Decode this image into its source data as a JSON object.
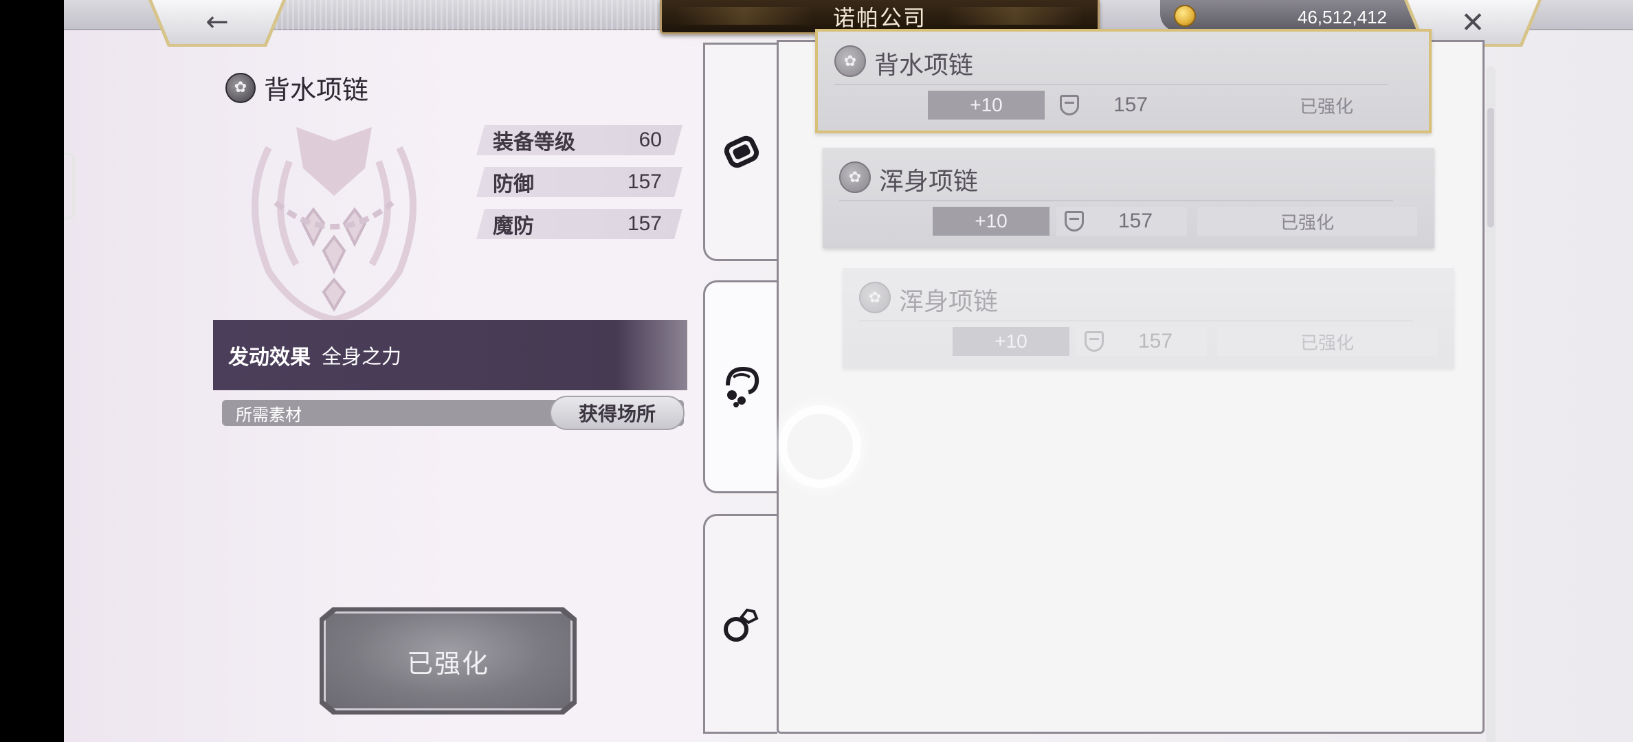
{
  "header": {
    "title": "诺帕公司",
    "back_icon": "←",
    "close_icon": "✕",
    "currency_value": "46,512,412"
  },
  "detail": {
    "item_name": "背水项链",
    "stats": [
      {
        "label": "装备等级",
        "value": "60"
      },
      {
        "label": "防御",
        "value": "157"
      },
      {
        "label": "魔防",
        "value": "157"
      }
    ],
    "effect_label": "发动效果",
    "effect_value": "全身之力",
    "materials_label": "所需素材",
    "source_button": "获得场所",
    "enhance_button": "已强化"
  },
  "tabs": [
    {
      "icon": "bracelet-icon"
    },
    {
      "icon": "necklace-icon"
    },
    {
      "icon": "ring-icon"
    }
  ],
  "list": [
    {
      "name": "背水项链",
      "level": "+10",
      "defense": "157",
      "status": "已强化",
      "selected": true
    },
    {
      "name": "浑身项链",
      "level": "+10",
      "defense": "157",
      "status": "已强化",
      "selected": false
    },
    {
      "name": "浑身项链",
      "level": "+10",
      "defense": "157",
      "status": "已强化",
      "selected": false
    }
  ],
  "colors": {
    "effect_bar": "#4b3e5a",
    "selected_border": "#d8c079",
    "title_plate": "#2a1d10"
  }
}
